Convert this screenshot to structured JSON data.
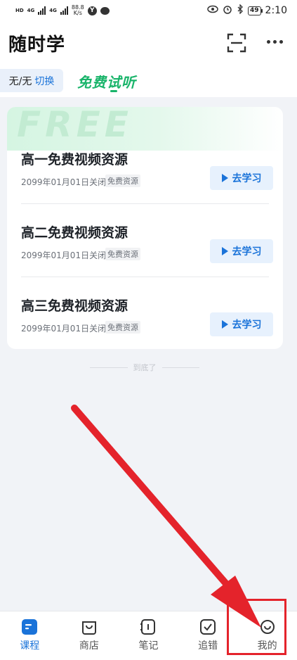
{
  "status_bar": {
    "net_speed_value": "88.8",
    "net_speed_unit": "K/s",
    "badge": "Y",
    "battery": "49",
    "time": "2:10",
    "network_labels": [
      "HD",
      "4G",
      "4G"
    ]
  },
  "header": {
    "title": "随时学"
  },
  "sub_row": {
    "switch_current": "无/无",
    "switch_action": "切换",
    "section_heading": "免费试听"
  },
  "card": {
    "banner_text": "FREE",
    "courses": [
      {
        "name": "高一免费视频资源",
        "date": "2099年01月01日关闭",
        "tag": "免费资源",
        "button": "去学习"
      },
      {
        "name": "高二免费视频资源",
        "date": "2099年01月01日关闭",
        "tag": "免费资源",
        "button": "去学习"
      },
      {
        "name": "高三免费视频资源",
        "date": "2099年01月01日关闭",
        "tag": "免费资源",
        "button": "去学习"
      }
    ]
  },
  "end_text": "到底了",
  "bottom_nav": [
    {
      "label": "课程",
      "icon": "course-icon",
      "active": true
    },
    {
      "label": "商店",
      "icon": "store-icon",
      "active": false
    },
    {
      "label": "笔记",
      "icon": "notes-icon",
      "active": false
    },
    {
      "label": "追错",
      "icon": "mistakes-icon",
      "active": false
    },
    {
      "label": "我的",
      "icon": "profile-icon",
      "active": false
    }
  ],
  "colors": {
    "accent": "#1a73d9",
    "free_green": "#19b46a",
    "annotation_red": "#e4232b"
  }
}
